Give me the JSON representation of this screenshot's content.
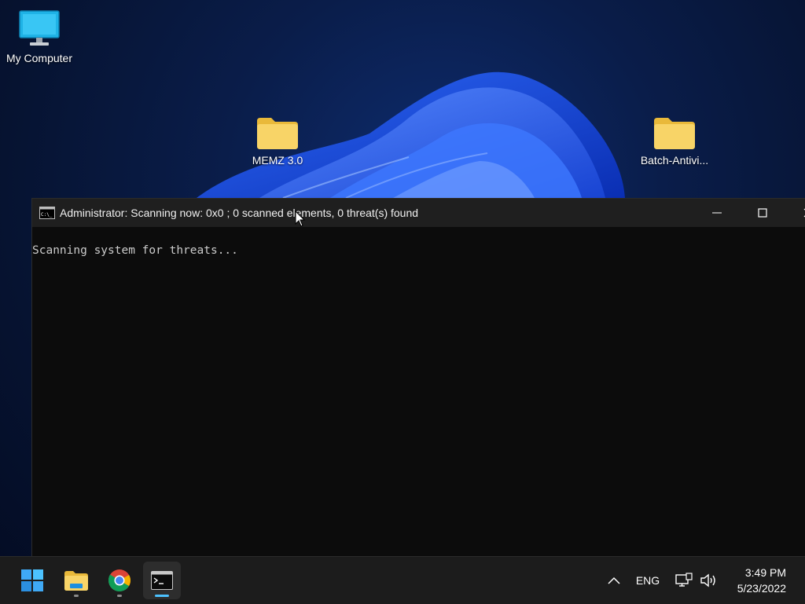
{
  "desktop": {
    "icons": [
      {
        "label": "My Computer",
        "icon": "computer-icon"
      },
      {
        "label": "MEMZ 3.0",
        "icon": "folder-icon"
      },
      {
        "label": "Batch-Antivi...",
        "icon": "folder-icon"
      }
    ]
  },
  "console": {
    "title": "Administrator:  Scanning now: 0x0 ; 0 scanned elements, 0 threat(s) found",
    "output": "Scanning system for threats...",
    "controls": {
      "minimize": "minimize-icon",
      "maximize": "maximize-icon",
      "close": "close-icon"
    }
  },
  "taskbar": {
    "apps": [
      {
        "name": "Start",
        "icon": "windows-start-icon",
        "running": false,
        "active": false
      },
      {
        "name": "File Explorer",
        "icon": "file-explorer-icon",
        "running": true,
        "active": false
      },
      {
        "name": "Google Chrome",
        "icon": "chrome-icon",
        "running": true,
        "active": false
      },
      {
        "name": "Command Prompt",
        "icon": "command-prompt-icon",
        "running": true,
        "active": true
      }
    ],
    "tray": {
      "language": "ENG",
      "time": "3:49 PM",
      "date": "5/23/2022"
    }
  },
  "colors": {
    "console_bg": "#0c0c0c",
    "titlebar_bg": "#1f1f1f",
    "taskbar_bg": "#1c1c1c",
    "accent": "#4cc2ff",
    "folder": "#f8d467"
  }
}
